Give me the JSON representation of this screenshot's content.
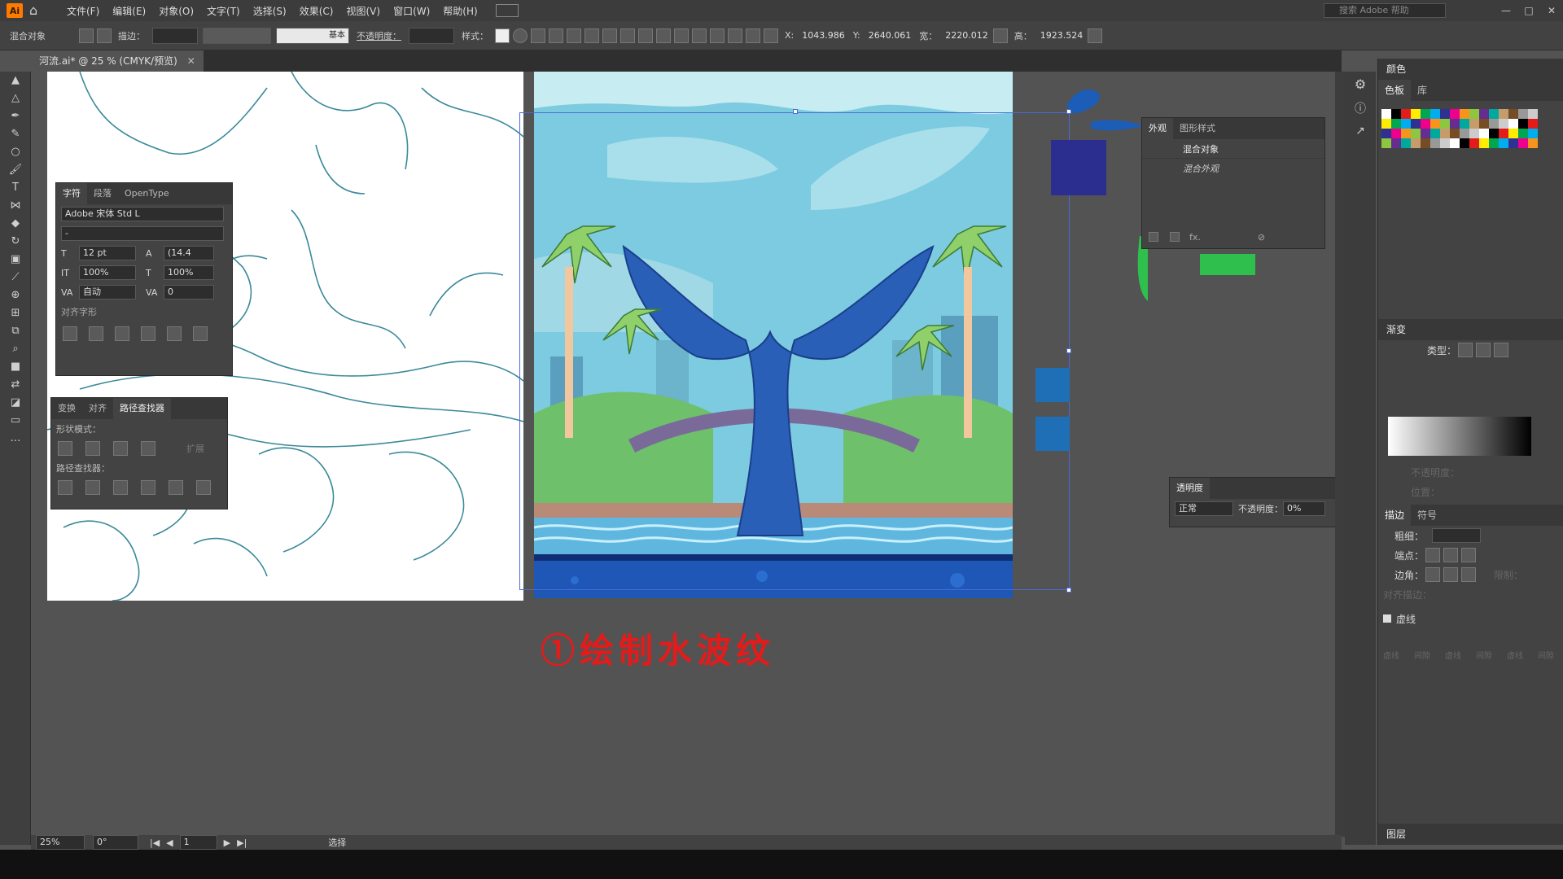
{
  "menubar": {
    "logo": "Ai",
    "items": [
      "文件(F)",
      "编辑(E)",
      "对象(O)",
      "文字(T)",
      "选择(S)",
      "效果(C)",
      "视图(V)",
      "窗口(W)",
      "帮助(H)"
    ],
    "search_placeholder": "搜索 Adobe 帮助"
  },
  "control": {
    "object_type": "混合对象",
    "stroke_label": "描边：",
    "stroke_style": "基本",
    "opacity_label": "不透明度：",
    "style_label": "样式：",
    "x_label": "X:",
    "x_value": "1043.986",
    "y_label": "Y:",
    "y_value": "2640.061",
    "w_label": "宽：",
    "w_value": "2220.012",
    "h_label": "高：",
    "h_value": "1923.524"
  },
  "document": {
    "tab_title": "河流.ai* @ 25 % (CMYK/预览)"
  },
  "character_panel": {
    "tabs": [
      "字符",
      "段落",
      "OpenType"
    ],
    "font": "Adobe 宋体 Std L",
    "style": "-",
    "size": "12 pt",
    "leading": "(14.4",
    "vscale": "100%",
    "hscale": "100%",
    "kerning": "自动",
    "tracking": "0",
    "align_glyph_label": "对齐字形"
  },
  "pathfinder_panel": {
    "tabs": [
      "变换",
      "对齐",
      "路径查找器"
    ],
    "shape_modes_label": "形状模式：",
    "expand_label": "扩展",
    "pathfinders_label": "路径查找器："
  },
  "appearance_panel": {
    "tabs": [
      "外观",
      "图形样式"
    ],
    "item1": "混合对象",
    "item2": "混合外观"
  },
  "transparency_panel": {
    "title": "透明度",
    "blend_mode": "正常",
    "opacity_label": "不透明度：",
    "opacity_value": "0%"
  },
  "right_panels": {
    "color_title": "颜色",
    "swatch_tabs": [
      "色板",
      "库"
    ],
    "gradient_title": "渐变",
    "gradient_type_label": "类型：",
    "gradient_opacity_label": "不透明度：",
    "gradient_position_label": "位置：",
    "stroke_tabs": [
      "描边",
      "符号"
    ],
    "weight_label": "粗细：",
    "cap_label": "端点：",
    "corner_label": "边角：",
    "align_stroke_label": "对齐描边：",
    "limit_label": "限制：",
    "dashed_label": "虚线",
    "dash_labels": [
      "虚线",
      "间隙",
      "虚线",
      "间隙",
      "虚线",
      "间隙"
    ],
    "layers_title": "图层"
  },
  "status": {
    "zoom": "25%",
    "rotation": "0°",
    "page": "1",
    "tool": "选择"
  },
  "caption": "①绘制水波纹",
  "swatch_colors": [
    "#ffffff",
    "#000000",
    "#e31b1b",
    "#ffec00",
    "#00a651",
    "#00aeef",
    "#2e3192",
    "#ec008c",
    "#f7941d",
    "#8dc63f",
    "#662d91",
    "#00a99d",
    "#c69c6d",
    "#754c24",
    "#999999",
    "#cccccc"
  ]
}
